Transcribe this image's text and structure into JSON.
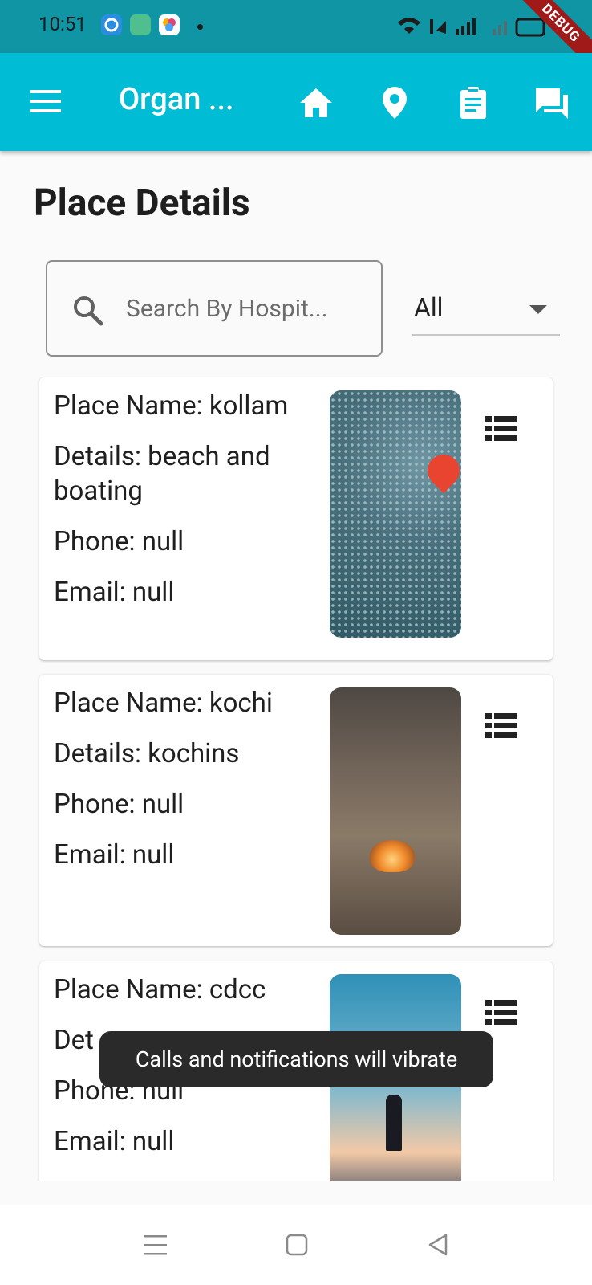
{
  "status_bar": {
    "time": "10:51",
    "debug_label": "DEBUG",
    "bg_color": "#0f95a4"
  },
  "app_bar": {
    "title": "Organ ...",
    "bg_color": "#00bcd4",
    "actions": [
      "menu-icon",
      "home-icon",
      "location-pin-icon",
      "clipboard-icon",
      "chat-icon"
    ]
  },
  "page": {
    "title": "Place Details"
  },
  "search": {
    "placeholder": "Search By Hospit..."
  },
  "filter": {
    "selected": "All"
  },
  "places": [
    {
      "name_line": "Place Name: kollam",
      "details_line": "Details: beach and boating",
      "phone_line": "Phone: null",
      "email_line": "Email: null"
    },
    {
      "name_line": "Place Name: kochi",
      "details_line": "Details: kochins",
      "phone_line": "Phone: null",
      "email_line": "Email: null"
    },
    {
      "name_line": "Place Name:  cdcc",
      "details_line": "Det",
      "phone_line": "Phone: null",
      "email_line": "Email: null"
    }
  ],
  "toast": {
    "message": "Calls and notifications will vibrate"
  }
}
